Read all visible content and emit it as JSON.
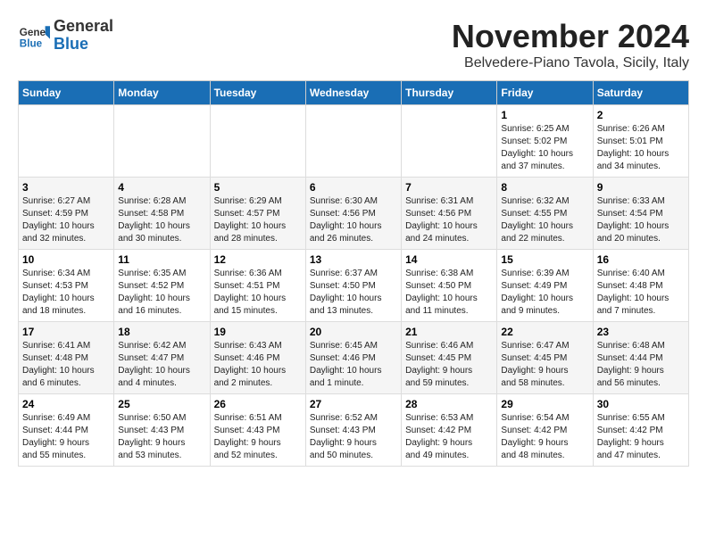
{
  "header": {
    "logo_line1": "General",
    "logo_line2": "Blue",
    "month_title": "November 2024",
    "location": "Belvedere-Piano Tavola, Sicily, Italy"
  },
  "days_of_week": [
    "Sunday",
    "Monday",
    "Tuesday",
    "Wednesday",
    "Thursday",
    "Friday",
    "Saturday"
  ],
  "weeks": [
    [
      {
        "num": "",
        "info": ""
      },
      {
        "num": "",
        "info": ""
      },
      {
        "num": "",
        "info": ""
      },
      {
        "num": "",
        "info": ""
      },
      {
        "num": "",
        "info": ""
      },
      {
        "num": "1",
        "info": "Sunrise: 6:25 AM\nSunset: 5:02 PM\nDaylight: 10 hours\nand 37 minutes."
      },
      {
        "num": "2",
        "info": "Sunrise: 6:26 AM\nSunset: 5:01 PM\nDaylight: 10 hours\nand 34 minutes."
      }
    ],
    [
      {
        "num": "3",
        "info": "Sunrise: 6:27 AM\nSunset: 4:59 PM\nDaylight: 10 hours\nand 32 minutes."
      },
      {
        "num": "4",
        "info": "Sunrise: 6:28 AM\nSunset: 4:58 PM\nDaylight: 10 hours\nand 30 minutes."
      },
      {
        "num": "5",
        "info": "Sunrise: 6:29 AM\nSunset: 4:57 PM\nDaylight: 10 hours\nand 28 minutes."
      },
      {
        "num": "6",
        "info": "Sunrise: 6:30 AM\nSunset: 4:56 PM\nDaylight: 10 hours\nand 26 minutes."
      },
      {
        "num": "7",
        "info": "Sunrise: 6:31 AM\nSunset: 4:56 PM\nDaylight: 10 hours\nand 24 minutes."
      },
      {
        "num": "8",
        "info": "Sunrise: 6:32 AM\nSunset: 4:55 PM\nDaylight: 10 hours\nand 22 minutes."
      },
      {
        "num": "9",
        "info": "Sunrise: 6:33 AM\nSunset: 4:54 PM\nDaylight: 10 hours\nand 20 minutes."
      }
    ],
    [
      {
        "num": "10",
        "info": "Sunrise: 6:34 AM\nSunset: 4:53 PM\nDaylight: 10 hours\nand 18 minutes."
      },
      {
        "num": "11",
        "info": "Sunrise: 6:35 AM\nSunset: 4:52 PM\nDaylight: 10 hours\nand 16 minutes."
      },
      {
        "num": "12",
        "info": "Sunrise: 6:36 AM\nSunset: 4:51 PM\nDaylight: 10 hours\nand 15 minutes."
      },
      {
        "num": "13",
        "info": "Sunrise: 6:37 AM\nSunset: 4:50 PM\nDaylight: 10 hours\nand 13 minutes."
      },
      {
        "num": "14",
        "info": "Sunrise: 6:38 AM\nSunset: 4:50 PM\nDaylight: 10 hours\nand 11 minutes."
      },
      {
        "num": "15",
        "info": "Sunrise: 6:39 AM\nSunset: 4:49 PM\nDaylight: 10 hours\nand 9 minutes."
      },
      {
        "num": "16",
        "info": "Sunrise: 6:40 AM\nSunset: 4:48 PM\nDaylight: 10 hours\nand 7 minutes."
      }
    ],
    [
      {
        "num": "17",
        "info": "Sunrise: 6:41 AM\nSunset: 4:48 PM\nDaylight: 10 hours\nand 6 minutes."
      },
      {
        "num": "18",
        "info": "Sunrise: 6:42 AM\nSunset: 4:47 PM\nDaylight: 10 hours\nand 4 minutes."
      },
      {
        "num": "19",
        "info": "Sunrise: 6:43 AM\nSunset: 4:46 PM\nDaylight: 10 hours\nand 2 minutes."
      },
      {
        "num": "20",
        "info": "Sunrise: 6:45 AM\nSunset: 4:46 PM\nDaylight: 10 hours\nand 1 minute."
      },
      {
        "num": "21",
        "info": "Sunrise: 6:46 AM\nSunset: 4:45 PM\nDaylight: 9 hours\nand 59 minutes."
      },
      {
        "num": "22",
        "info": "Sunrise: 6:47 AM\nSunset: 4:45 PM\nDaylight: 9 hours\nand 58 minutes."
      },
      {
        "num": "23",
        "info": "Sunrise: 6:48 AM\nSunset: 4:44 PM\nDaylight: 9 hours\nand 56 minutes."
      }
    ],
    [
      {
        "num": "24",
        "info": "Sunrise: 6:49 AM\nSunset: 4:44 PM\nDaylight: 9 hours\nand 55 minutes."
      },
      {
        "num": "25",
        "info": "Sunrise: 6:50 AM\nSunset: 4:43 PM\nDaylight: 9 hours\nand 53 minutes."
      },
      {
        "num": "26",
        "info": "Sunrise: 6:51 AM\nSunset: 4:43 PM\nDaylight: 9 hours\nand 52 minutes."
      },
      {
        "num": "27",
        "info": "Sunrise: 6:52 AM\nSunset: 4:43 PM\nDaylight: 9 hours\nand 50 minutes."
      },
      {
        "num": "28",
        "info": "Sunrise: 6:53 AM\nSunset: 4:42 PM\nDaylight: 9 hours\nand 49 minutes."
      },
      {
        "num": "29",
        "info": "Sunrise: 6:54 AM\nSunset: 4:42 PM\nDaylight: 9 hours\nand 48 minutes."
      },
      {
        "num": "30",
        "info": "Sunrise: 6:55 AM\nSunset: 4:42 PM\nDaylight: 9 hours\nand 47 minutes."
      }
    ]
  ]
}
